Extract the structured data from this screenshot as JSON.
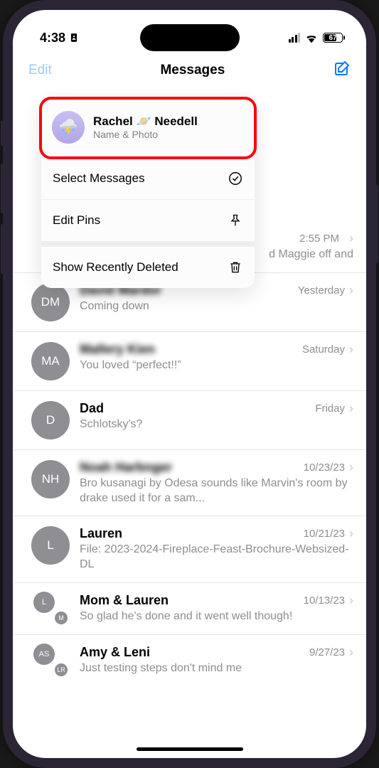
{
  "status": {
    "time": "4:38",
    "battery_pct": "67"
  },
  "header": {
    "edit": "Edit",
    "title": "Messages"
  },
  "edit_menu": {
    "profile_name": "Rachel 🪐 Needell",
    "profile_sub": "Name & Photo",
    "select_messages": "Select Messages",
    "edit_pins": "Edit Pins",
    "show_deleted": "Show Recently Deleted"
  },
  "conversations": [
    {
      "avatar": "",
      "name": "",
      "blurred_name": true,
      "time": "2:55 PM",
      "preview": "d Maggie off and",
      "preview_align_right": true
    },
    {
      "avatar": "DM",
      "name": "David Mardor",
      "blurred_name": true,
      "time": "Yesterday",
      "preview": "Coming down"
    },
    {
      "avatar": "MA",
      "name": "Mallery Kien",
      "blurred_name": true,
      "time": "Saturday",
      "preview": "You loved “perfect!!”"
    },
    {
      "avatar": "D",
      "name": "Dad",
      "time": "Friday",
      "preview": "Schlotsky's?"
    },
    {
      "avatar": "NH",
      "name": "Noah Harbnger",
      "blurred_name": true,
      "time": "10/23/23",
      "preview": "Bro kusanagi by Odesa sounds like Marvin's room by drake used it for a sam..."
    },
    {
      "avatar": "L",
      "name": "Lauren",
      "time": "10/21/23",
      "preview": "File: 2023-2024-Fireplace-Feast-Brochure-Websized-DL"
    },
    {
      "avatar_group": [
        "L",
        "M"
      ],
      "name": "Mom & Lauren",
      "time": "10/13/23",
      "preview": "So glad he's done and it went well though!"
    },
    {
      "avatar_group": [
        "AS",
        "LR"
      ],
      "name": "Amy & Leni",
      "time": "9/27/23",
      "preview": "Just testing steps don't mind me"
    }
  ]
}
